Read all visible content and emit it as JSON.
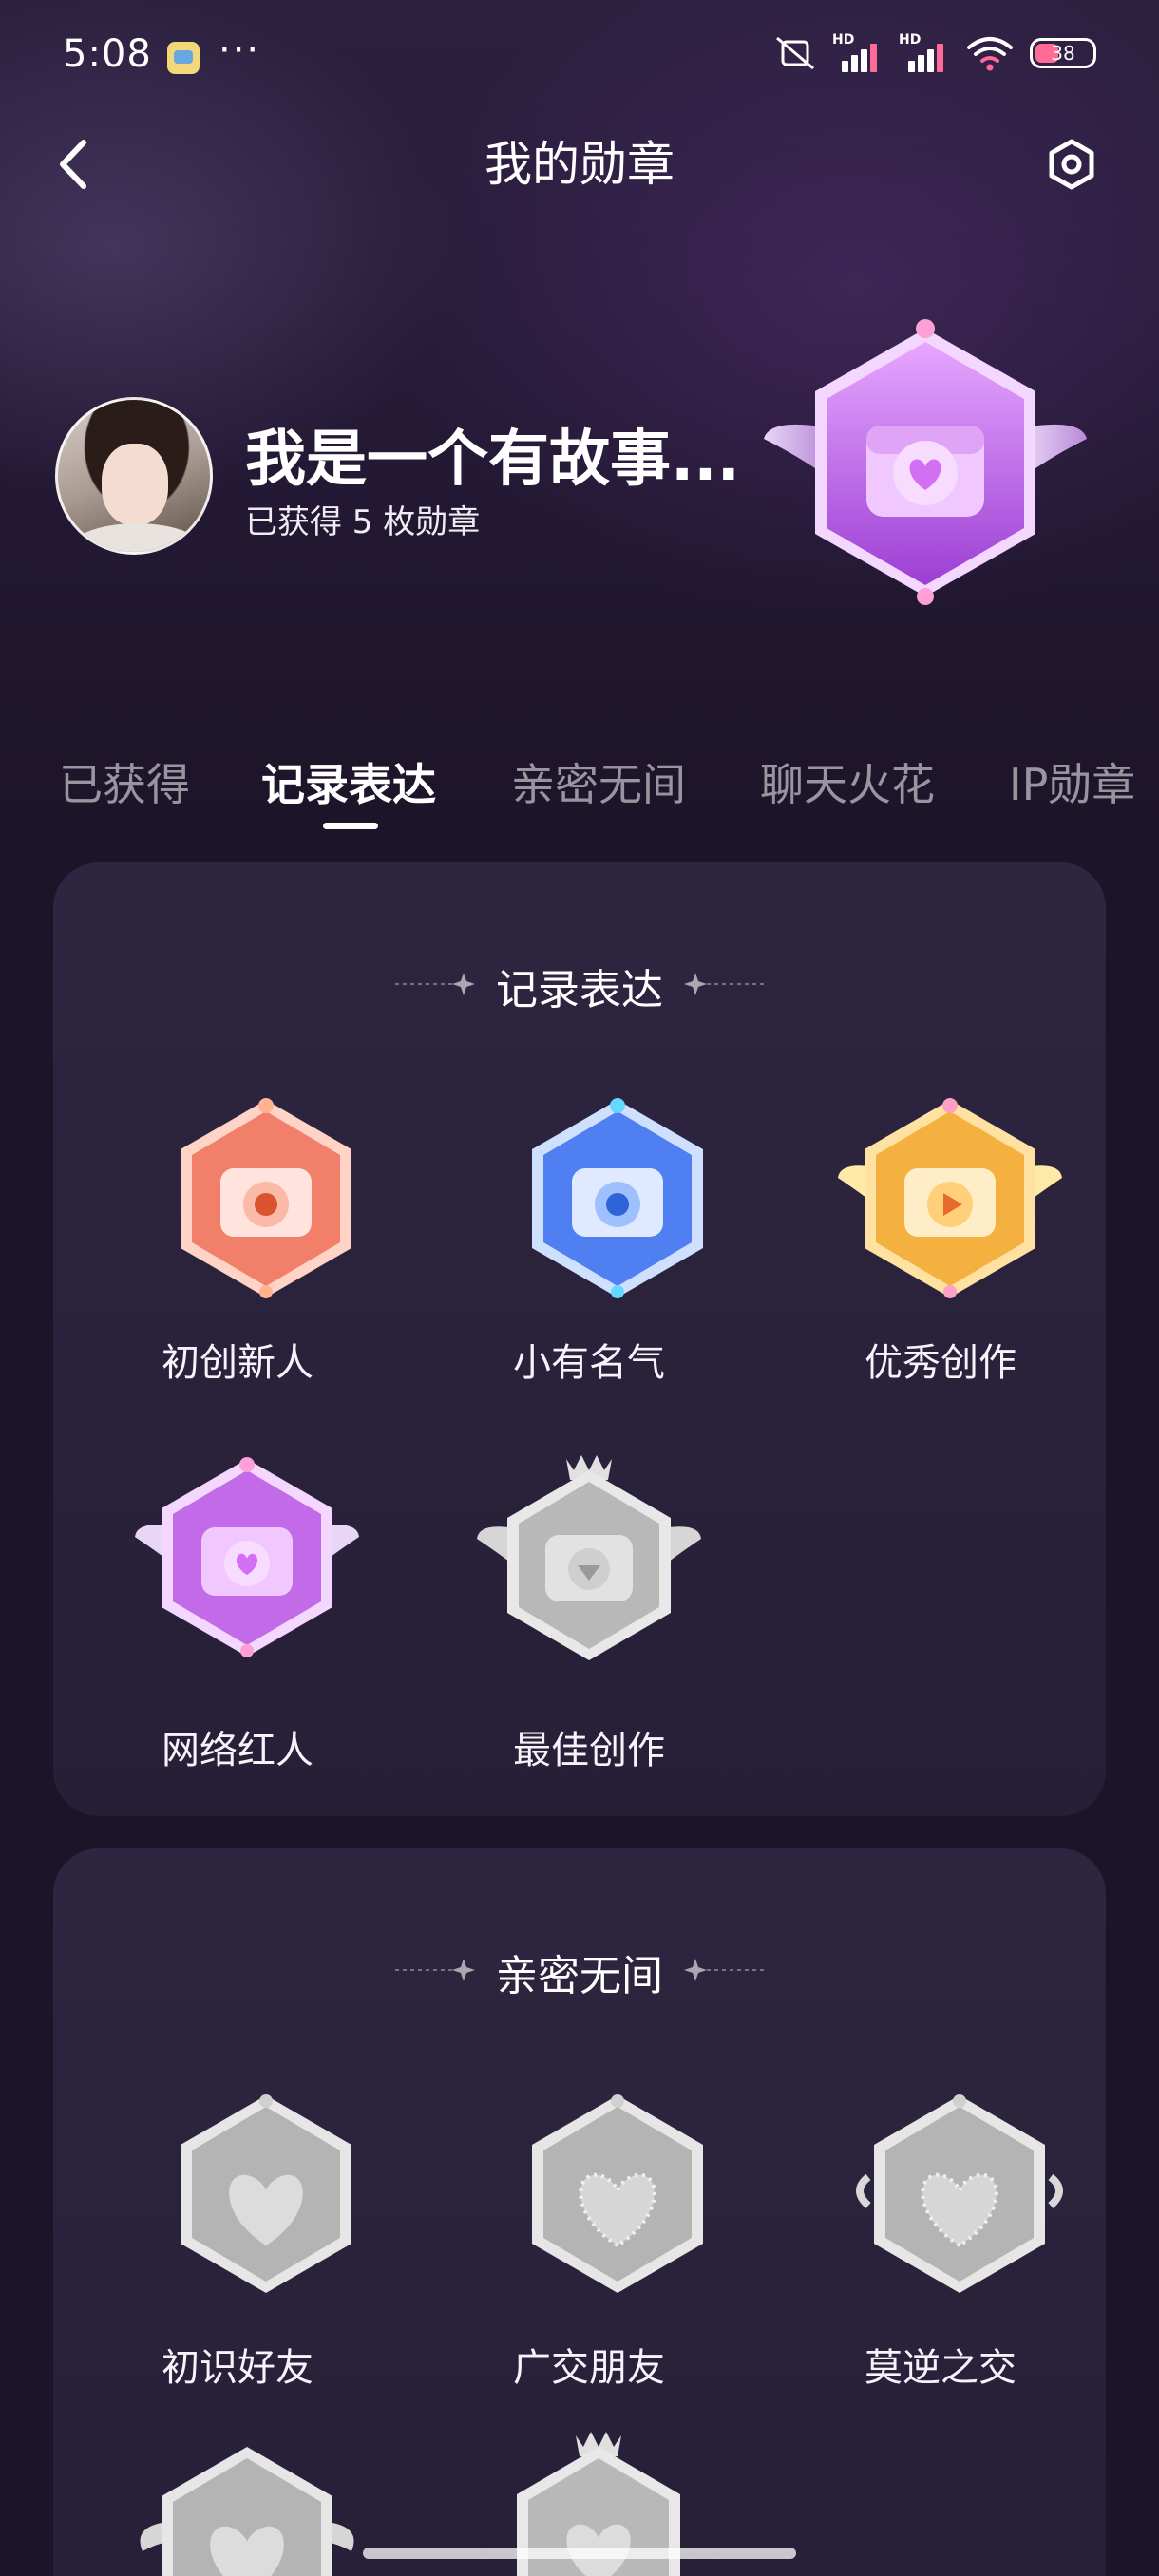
{
  "status_bar": {
    "time": "5:08",
    "more": "···",
    "signal_tag_1": "HD",
    "signal_tag_2": "HD",
    "battery_level": "38"
  },
  "header": {
    "title": "我的勋章",
    "back_icon": "chevron-left-icon",
    "settings_icon": "hexagon-settings-icon"
  },
  "profile": {
    "name": "我是一个有故事...",
    "badge_count": "已获得 5 枚勋章",
    "featured_badge": "网络红人"
  },
  "tabs": [
    {
      "label": "已获得",
      "active": false
    },
    {
      "label": "记录表达",
      "active": true
    },
    {
      "label": "亲密无间",
      "active": false
    },
    {
      "label": "聊天火花",
      "active": false
    },
    {
      "label": "IP勋章",
      "active": false
    }
  ],
  "sections": [
    {
      "title": "记录表达",
      "badges": [
        {
          "label": "初创新人",
          "color": "#f27f6a",
          "earned": true
        },
        {
          "label": "小有名气",
          "color": "#4f7ff0",
          "earned": true
        },
        {
          "label": "优秀创作",
          "color": "#f5b13f",
          "earned": true
        },
        {
          "label": "网络红人",
          "color": "#c36ae8",
          "earned": true
        },
        {
          "label": "最佳创作",
          "color": "#bdbdbd",
          "earned": false
        }
      ]
    },
    {
      "title": "亲密无间",
      "badges": [
        {
          "label": "初识好友",
          "color": "#bdbdbd",
          "earned": false
        },
        {
          "label": "广交朋友",
          "color": "#bdbdbd",
          "earned": false
        },
        {
          "label": "莫逆之交",
          "color": "#bdbdbd",
          "earned": false
        },
        {
          "label": "",
          "color": "#bdbdbd",
          "earned": false
        },
        {
          "label": "",
          "color": "#bdbdbd",
          "earned": false
        }
      ]
    }
  ],
  "colors": {
    "background": "#1c1428",
    "card": "#2a2239",
    "accent_purple": "#c36ae8"
  }
}
